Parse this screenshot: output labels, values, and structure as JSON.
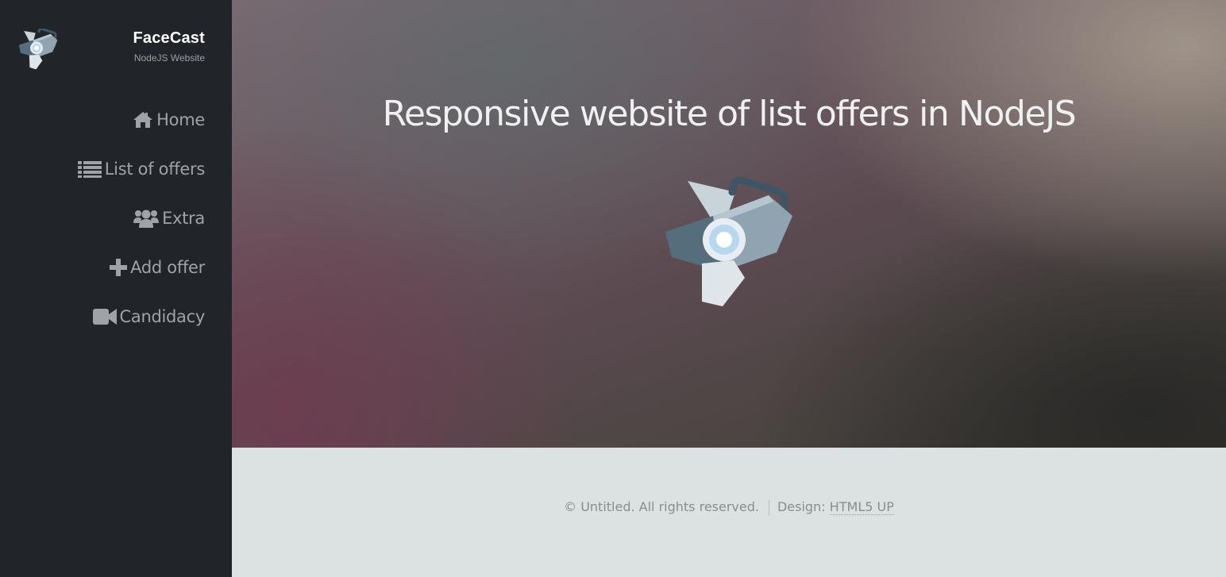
{
  "brand": {
    "title": "FaceCast",
    "subtitle": "NodeJS Website",
    "logo_icon": "spotlight-icon"
  },
  "nav": {
    "items": [
      {
        "label": "Home",
        "icon": "home-icon"
      },
      {
        "label": "List of offers",
        "icon": "list-icon"
      },
      {
        "label": "Extra",
        "icon": "users-icon"
      },
      {
        "label": "Add offer",
        "icon": "plus-icon"
      },
      {
        "label": "Candidacy",
        "icon": "video-camera-icon"
      }
    ]
  },
  "banner": {
    "title": "Responsive website of list offers in NodeJS",
    "illustration_icon": "spotlight-icon"
  },
  "footer": {
    "copyright": "© Untitled. All rights reserved.",
    "design_label": "Design:",
    "design_link": "HTML5 UP"
  },
  "colors": {
    "sidebar_bg": "#212529",
    "nav_text": "#9ea3a8",
    "footer_bg": "#dce1e2",
    "footer_text": "#888d92"
  }
}
